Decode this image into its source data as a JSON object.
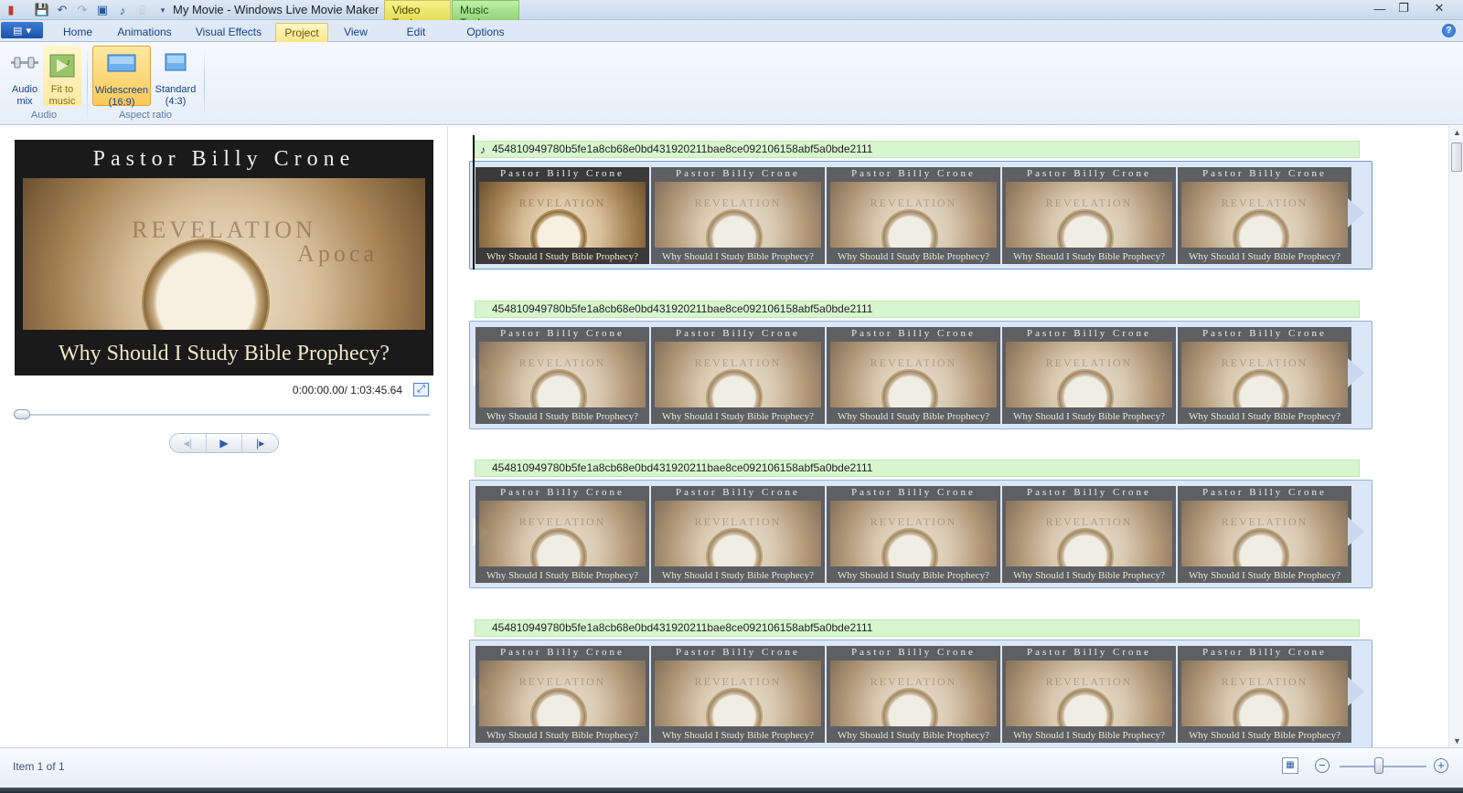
{
  "window": {
    "title": "My Movie - Windows Live Movie Maker",
    "context_tabs": {
      "video_tools": "Video Tools",
      "music_tools": "Music Tools"
    },
    "controls": {
      "minimize": "—",
      "restore": "❐",
      "close": "✕"
    }
  },
  "quick_access": [
    "save-icon",
    "undo-icon",
    "redo-icon",
    "add-video-icon",
    "add-music-icon",
    "new-project-icon",
    "customize-icon"
  ],
  "ribbon_tabs": [
    {
      "label": "Home"
    },
    {
      "label": "Animations"
    },
    {
      "label": "Visual Effects"
    },
    {
      "label": "Project",
      "active": true
    },
    {
      "label": "View"
    },
    {
      "label": "Edit"
    },
    {
      "label": "Options"
    }
  ],
  "ribbon": {
    "audio_mix": "Audio mix",
    "fit_to_music": "Fit to music",
    "widescreen": "Widescreen (16:9)",
    "standard": "Standard (4:3)",
    "group_audio": "Audio",
    "group_aspect": "Aspect ratio"
  },
  "preview": {
    "poster_top": "Pastor Billy Crone",
    "poster_word": "REVELATION",
    "poster_word2": "Apoca",
    "poster_bottom": "Why Should I Study Bible Prophecy?",
    "time": "0:00:00.00/ 1:03:45.64",
    "seek_position_percent": 0
  },
  "storyboard": {
    "rows": [
      {
        "music_label": "454810949780b5fe1a8cb68e0bd431920211bae8ce092106158abf5a0bde2111",
        "has_note": true,
        "first_row": true
      },
      {
        "music_label": "454810949780b5fe1a8cb68e0bd431920211bae8ce092106158abf5a0bde2111",
        "has_note": false,
        "first_row": false
      },
      {
        "music_label": "454810949780b5fe1a8cb68e0bd431920211bae8ce092106158abf5a0bde2111",
        "has_note": false,
        "first_row": false
      },
      {
        "music_label": "454810949780b5fe1a8cb68e0bd431920211bae8ce092106158abf5a0bde2111",
        "has_note": false,
        "first_row": false
      }
    ],
    "frame_top": "Pastor Billy Crone",
    "frame_word": "REVELATION",
    "frame_bottom": "Why Should I Study Bible Prophecy?"
  },
  "status": {
    "text": "Item 1 of 1",
    "zoom_percent": 45
  },
  "colors": {
    "music_bar": "#d7f6cf",
    "active_tab": "#fbe68a",
    "accent": "#2b63b5"
  }
}
